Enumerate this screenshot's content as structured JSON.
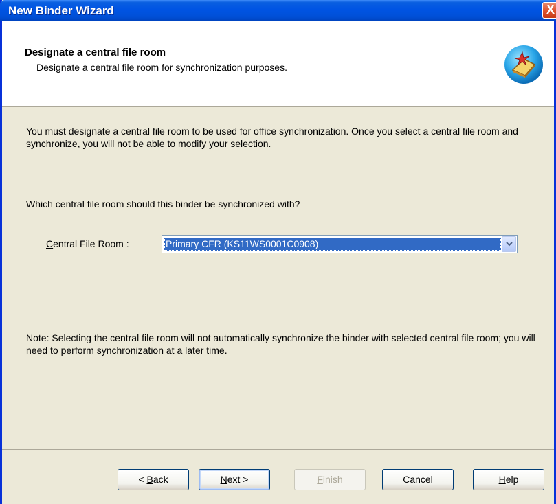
{
  "window": {
    "title": "New Binder Wizard",
    "close_label": "X"
  },
  "header": {
    "title": "Designate a central file room",
    "subtitle": "Designate a central file room for synchronization purposes.",
    "icon": "binder-wizard-icon"
  },
  "content": {
    "paragraph": "You must designate a central file room to be used for office synchronization. Once you select a central file room and synchronize, you will not be able to modify your selection.",
    "question": "Which central file room should this binder be synchronized with?",
    "cfr_label_prefix": "C",
    "cfr_label_rest": "entral File Room :",
    "cfr_selected": "Primary CFR (KS11WS0001C0908)",
    "note": "Note: Selecting the central file room will not automatically synchronize the binder with selected central file room; you will need to perform synchronization at a later time."
  },
  "buttons": {
    "back_prefix": "< ",
    "back_u": "B",
    "back_rest": "ack",
    "next_u": "N",
    "next_rest": "ext >",
    "finish_u": "F",
    "finish_rest": "inish",
    "cancel": "Cancel",
    "help_u": "H",
    "help_rest": "elp"
  },
  "colors": {
    "titlebar": "#0054e3",
    "selection": "#316ac5",
    "face": "#ece9d8"
  }
}
